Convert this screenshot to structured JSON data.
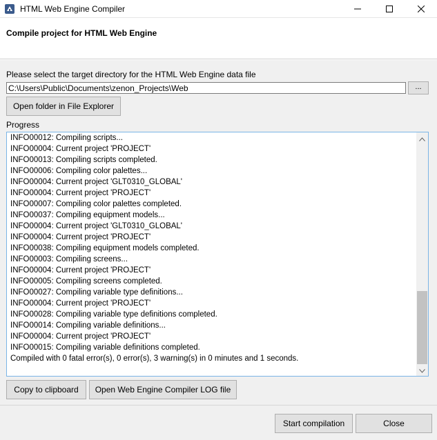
{
  "window": {
    "title": "HTML Web Engine Compiler",
    "app_icon": "compiler-app-icon",
    "controls": [
      "minimize-icon",
      "maximize-icon",
      "close-icon"
    ]
  },
  "header": {
    "title": "Compile project for HTML Web Engine"
  },
  "target": {
    "label": "Please select the target directory for the HTML Web Engine data file",
    "path": "C:\\Users\\Public\\Documents\\zenon_Projects\\Web",
    "browse_label": "...",
    "open_folder_label": "Open folder in File Explorer"
  },
  "progress": {
    "label": "Progress",
    "lines": [
      "INFO00012: Compiling scripts...",
      "INFO00004: Current project 'PROJECT'",
      "INFO00013: Compiling scripts completed.",
      "INFO00006: Compiling color palettes...",
      "INFO00004: Current project 'GLT0310_GLOBAL'",
      "INFO00004: Current project 'PROJECT'",
      "INFO00007: Compiling color palettes completed.",
      "INFO00037: Compiling equipment models...",
      "INFO00004: Current project 'GLT0310_GLOBAL'",
      "INFO00004: Current project 'PROJECT'",
      "INFO00038: Compiling equipment models completed.",
      "INFO00003: Compiling screens...",
      "INFO00004: Current project 'PROJECT'",
      "INFO00005: Compiling screens completed.",
      "INFO00027: Compiling variable type definitions...",
      "INFO00004: Current project 'PROJECT'",
      "INFO00028: Compiling variable type definitions completed.",
      "INFO00014: Compiling variable definitions...",
      "INFO00004: Current project 'PROJECT'",
      "INFO00015: Compiling variable definitions completed.",
      "Compiled with 0 fatal error(s), 0 error(s), 3 warning(s) in 0 minutes and 1 seconds."
    ],
    "copy_label": "Copy to clipboard",
    "open_log_label": "Open Web Engine Compiler LOG file"
  },
  "footer": {
    "start_label": "Start compilation",
    "close_label": "Close"
  },
  "colors": {
    "dialog_background": "#f0f0f0",
    "log_border": "#7ab4e6",
    "button_background": "#e1e1e1"
  }
}
